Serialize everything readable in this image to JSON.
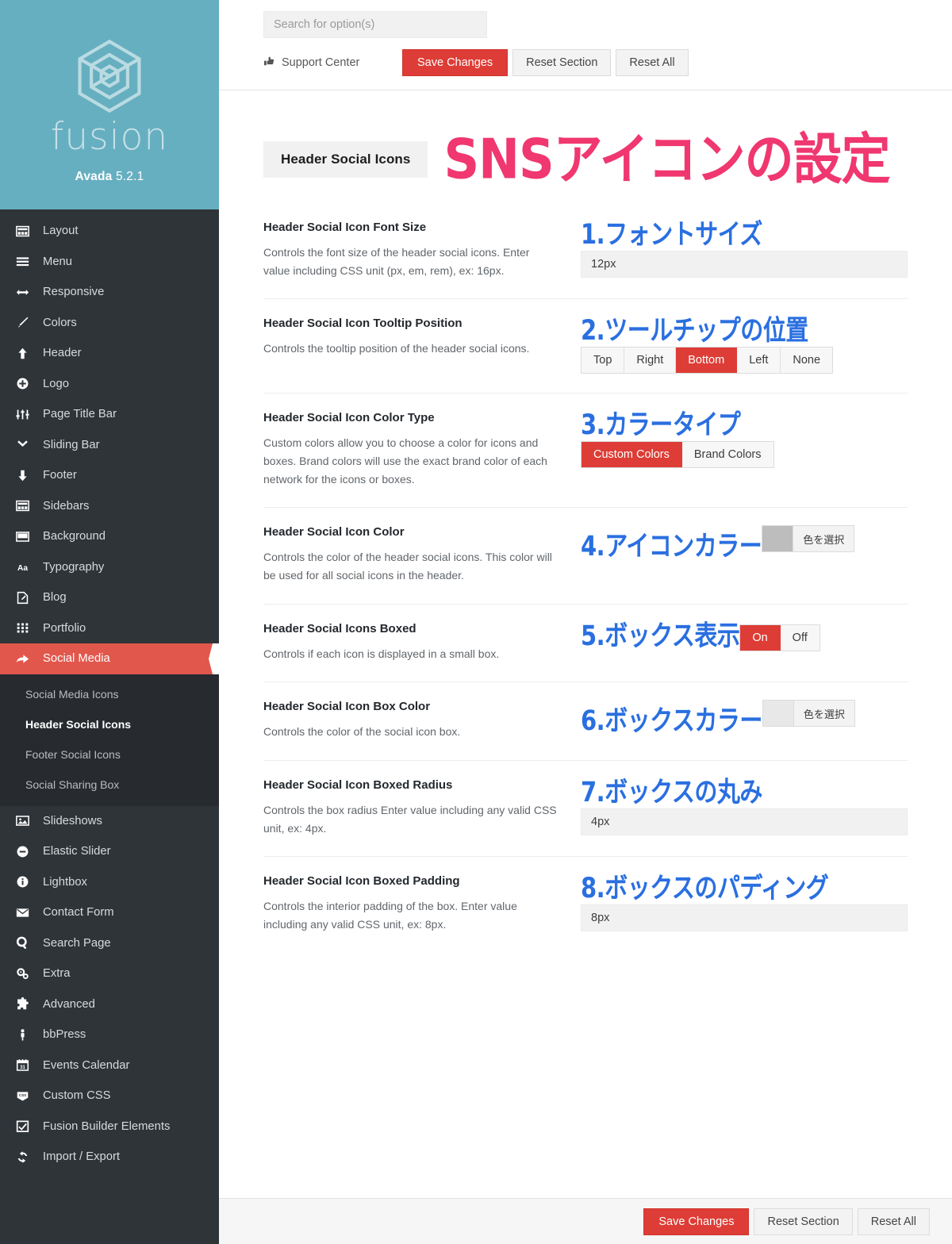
{
  "brand": {
    "logo_icon": "fusion-hexagon-logo",
    "wordmark": "fusion",
    "product": "Avada",
    "version": "5.2.1",
    "bg_color": "#66afc0"
  },
  "sidebar": {
    "items": [
      {
        "label": "Layout",
        "icon": "layout-icon"
      },
      {
        "label": "Menu",
        "icon": "menu-bars-icon"
      },
      {
        "label": "Responsive",
        "icon": "arrows-horizontal-icon"
      },
      {
        "label": "Colors",
        "icon": "brush-icon"
      },
      {
        "label": "Header",
        "icon": "arrow-up-icon"
      },
      {
        "label": "Logo",
        "icon": "plus-circle-icon"
      },
      {
        "label": "Page Title Bar",
        "icon": "sliders-icon"
      },
      {
        "label": "Sliding Bar",
        "icon": "chevron-down-icon"
      },
      {
        "label": "Footer",
        "icon": "arrow-down-icon"
      },
      {
        "label": "Sidebars",
        "icon": "sidebar-icon"
      },
      {
        "label": "Background",
        "icon": "background-icon"
      },
      {
        "label": "Typography",
        "icon": "typography-aa-icon"
      },
      {
        "label": "Blog",
        "icon": "pencil-note-icon"
      },
      {
        "label": "Portfolio",
        "icon": "grid-dots-icon"
      },
      {
        "label": "Social Media",
        "icon": "share-arrow-icon",
        "active": true
      },
      {
        "label": "Slideshows",
        "icon": "image-icon"
      },
      {
        "label": "Elastic Slider",
        "icon": "minus-circle-icon"
      },
      {
        "label": "Lightbox",
        "icon": "info-circle-icon"
      },
      {
        "label": "Contact Form",
        "icon": "envelope-icon"
      },
      {
        "label": "Search Page",
        "icon": "search-icon"
      },
      {
        "label": "Extra",
        "icon": "gears-icon"
      },
      {
        "label": "Advanced",
        "icon": "puzzle-piece-icon"
      },
      {
        "label": "bbPress",
        "icon": "person-icon"
      },
      {
        "label": "Events Calendar",
        "icon": "calendar-31-icon"
      },
      {
        "label": "Custom CSS",
        "icon": "css-badge-icon"
      },
      {
        "label": "Fusion Builder Elements",
        "icon": "checkbox-square-icon"
      },
      {
        "label": "Import / Export",
        "icon": "refresh-arrows-icon"
      }
    ],
    "submenu": [
      {
        "label": "Social Media Icons",
        "current": false
      },
      {
        "label": "Header Social Icons",
        "current": true
      },
      {
        "label": "Footer Social Icons",
        "current": false
      },
      {
        "label": "Social Sharing Box",
        "current": false
      }
    ],
    "active_color": "#e2574c",
    "bg_color": "#2f3439",
    "submenu_bg_color": "#272b30"
  },
  "topbar": {
    "search_placeholder": "Search for option(s)",
    "search_value": "",
    "support_label": "Support Center",
    "support_icon": "thumbs-up-icon",
    "save_label": "Save Changes",
    "reset_section_label": "Reset Section",
    "reset_all_label": "Reset All",
    "primary_color": "#dd3d36"
  },
  "section": {
    "chip_label": "Header Social Icons",
    "jp_title": "SNSアイコンの設定",
    "jp_title_color": "#f0376f"
  },
  "options": [
    {
      "title": "Header Social Icon Font Size",
      "desc": "Controls the font size of the header social icons. Enter value including CSS unit (px, em, rem), ex: 16px.",
      "jp": "1.フォントサイズ",
      "control": "text",
      "value": "12px"
    },
    {
      "title": "Header Social Icon Tooltip Position",
      "desc": "Controls the tooltip position of the header social icons.",
      "jp": "2.ツールチップの位置",
      "control": "buttonset",
      "buttons": [
        "Top",
        "Right",
        "Bottom",
        "Left",
        "None"
      ],
      "selected": "Bottom"
    },
    {
      "title": "Header Social Icon Color Type",
      "desc": "Custom colors allow you to choose a color for icons and boxes. Brand colors will use the exact brand color of each network for the icons or boxes.",
      "jp": "3.カラータイプ",
      "control": "buttonset",
      "buttons": [
        "Custom Colors",
        "Brand Colors"
      ],
      "selected": "Custom Colors"
    },
    {
      "title": "Header Social Icon Color",
      "desc": "Controls the color of the header social icons. This color will be used for all social icons in the header.",
      "jp": "4.アイコンカラー",
      "control": "color",
      "swatch": "#bdbdbd",
      "picker_label": "色を選択"
    },
    {
      "title": "Header Social Icons Boxed",
      "desc": "Controls if each icon is displayed in a small box.",
      "jp": "5.ボックス表示",
      "control": "buttonset",
      "buttons": [
        "On",
        "Off"
      ],
      "selected": "On"
    },
    {
      "title": "Header Social Icon Box Color",
      "desc": "Controls the color of the social icon box.",
      "jp": "6.ボックスカラー",
      "control": "color",
      "swatch": "#e8e8e8",
      "picker_label": "色を選択"
    },
    {
      "title": "Header Social Icon Boxed Radius",
      "desc": "Controls the box radius Enter value including any valid CSS unit, ex: 4px.",
      "jp": "7.ボックスの丸み",
      "control": "text",
      "value": "4px"
    },
    {
      "title": "Header Social Icon Boxed Padding",
      "desc": "Controls the interior padding of the box. Enter value including any valid CSS unit, ex: 8px.",
      "jp": "8.ボックスのパディング",
      "control": "text",
      "value": "8px"
    }
  ],
  "footerbar": {
    "save_label": "Save Changes",
    "reset_section_label": "Reset Section",
    "reset_all_label": "Reset All"
  }
}
